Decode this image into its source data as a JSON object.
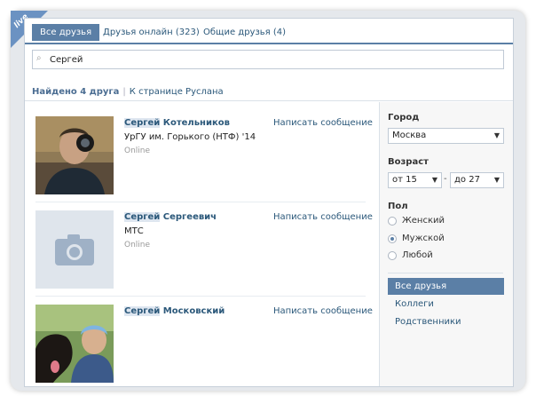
{
  "badge": {
    "text": "live"
  },
  "tabs": [
    {
      "label": "Все друзья"
    },
    {
      "label": "Друзья онлайн (323)"
    },
    {
      "label": "Общие друзья (4)"
    }
  ],
  "search": {
    "value": "Сергей",
    "icon": "search-icon"
  },
  "summary": {
    "count": "Найдено 4 друга",
    "separator": "|",
    "back_link": "К странице Руслана"
  },
  "friends": [
    {
      "first_name": "Сергей",
      "last_name": "Котельников",
      "info": "УрГУ им. Горького (НТФ) '14",
      "status": "Online",
      "action": "Написать сообщение"
    },
    {
      "first_name": "Сергей",
      "last_name": "Сергеевич",
      "info": "МТС",
      "status": "Online",
      "action": "Написать сообщение"
    },
    {
      "first_name": "Сергей",
      "last_name": "Московский",
      "info": "",
      "status": "",
      "action": "Написать сообщение"
    }
  ],
  "filters": {
    "city": {
      "label": "Город",
      "value": "Москва"
    },
    "age": {
      "label": "Возраст",
      "from": "от 15",
      "separator": "-",
      "to": "до 27"
    },
    "sex": {
      "label": "Пол",
      "options": [
        "Женский",
        "Мужской",
        "Любой"
      ],
      "selected": "Мужской"
    },
    "categories": [
      "Все друзья",
      "Коллеги",
      "Родственники"
    ]
  },
  "colors": {
    "accent": "#5b7fa6",
    "link": "#2b587a",
    "badge": "#6b92c2"
  }
}
